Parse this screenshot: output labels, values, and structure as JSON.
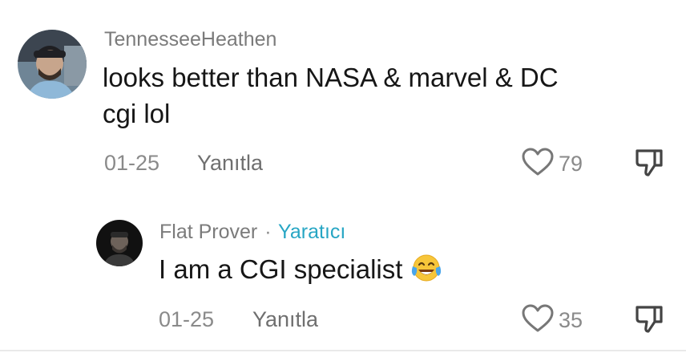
{
  "comments": [
    {
      "username": "TennesseeHeathen",
      "text_line1": "looks better than NASA & marvel & DC",
      "text_line2": "cgi lol",
      "date": "01-25",
      "reply_label": "Yanıtla",
      "likes": "79"
    }
  ],
  "replies": [
    {
      "username": "Flat Prover",
      "separator": "·",
      "creator_label": "Yaratıcı",
      "text": "I am a CGI specialist",
      "emoji": "face-with-tears-of-joy",
      "date": "01-25",
      "reply_label": "Yanıtla",
      "likes": "35"
    }
  ],
  "colors": {
    "username": "#7b7b7b",
    "body": "#161616",
    "meta": "#8a8a8a",
    "creator_accent": "#27a6c4"
  },
  "icons": {
    "like": "heart-outline-icon",
    "dislike": "thumbs-down-outline-icon"
  }
}
